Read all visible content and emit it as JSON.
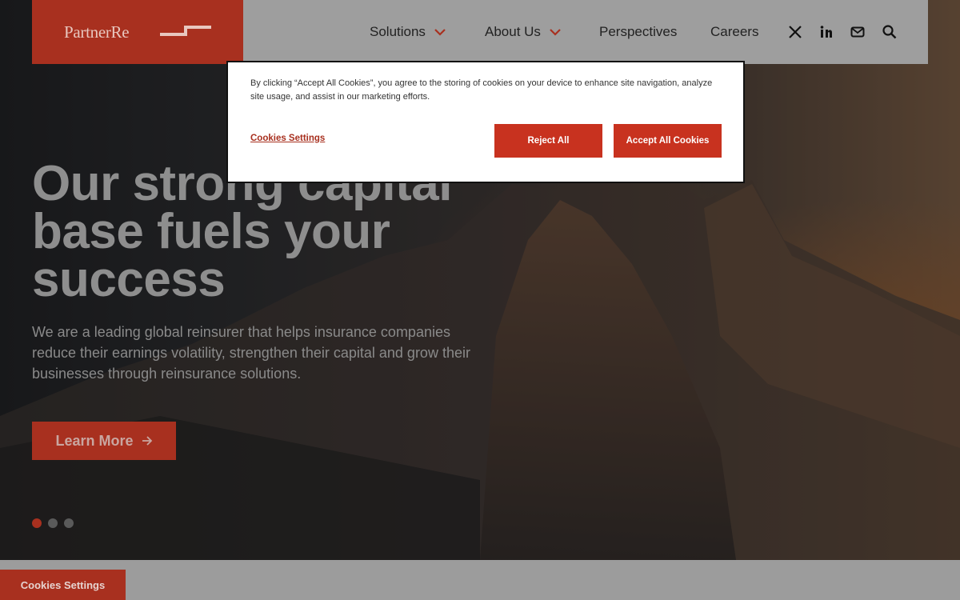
{
  "header": {
    "logo_text": "PartnerRe",
    "nav": [
      {
        "label": "Solutions",
        "has_dropdown": true
      },
      {
        "label": "About Us",
        "has_dropdown": true
      },
      {
        "label": "Perspectives",
        "has_dropdown": false
      },
      {
        "label": "Careers",
        "has_dropdown": false
      }
    ],
    "icons": [
      "x-twitter-icon",
      "linkedin-icon",
      "mail-icon",
      "search-icon"
    ]
  },
  "hero": {
    "headline": "Our strong capital base fuels your success",
    "subcopy": "We are a leading global reinsurer that helps insurance companies reduce their earnings volatility, strengthen their capital and grow their businesses through reinsurance solutions.",
    "cta_label": "Learn More",
    "slides": 3,
    "active_slide": 1
  },
  "cookie_banner": {
    "text": "By clicking “Accept All Cookies”, you agree to the storing of cookies on your device to enhance site navigation, analyze site usage, and assist in our marketing efforts.",
    "settings_link": "Cookies Settings",
    "reject_label": "Reject All",
    "accept_label": "Accept All Cookies"
  },
  "floating_button": {
    "label": "Cookies Settings"
  },
  "colors": {
    "brand": "#a8301f",
    "button": "#c8321f",
    "overlay": "#9c9c9c"
  }
}
